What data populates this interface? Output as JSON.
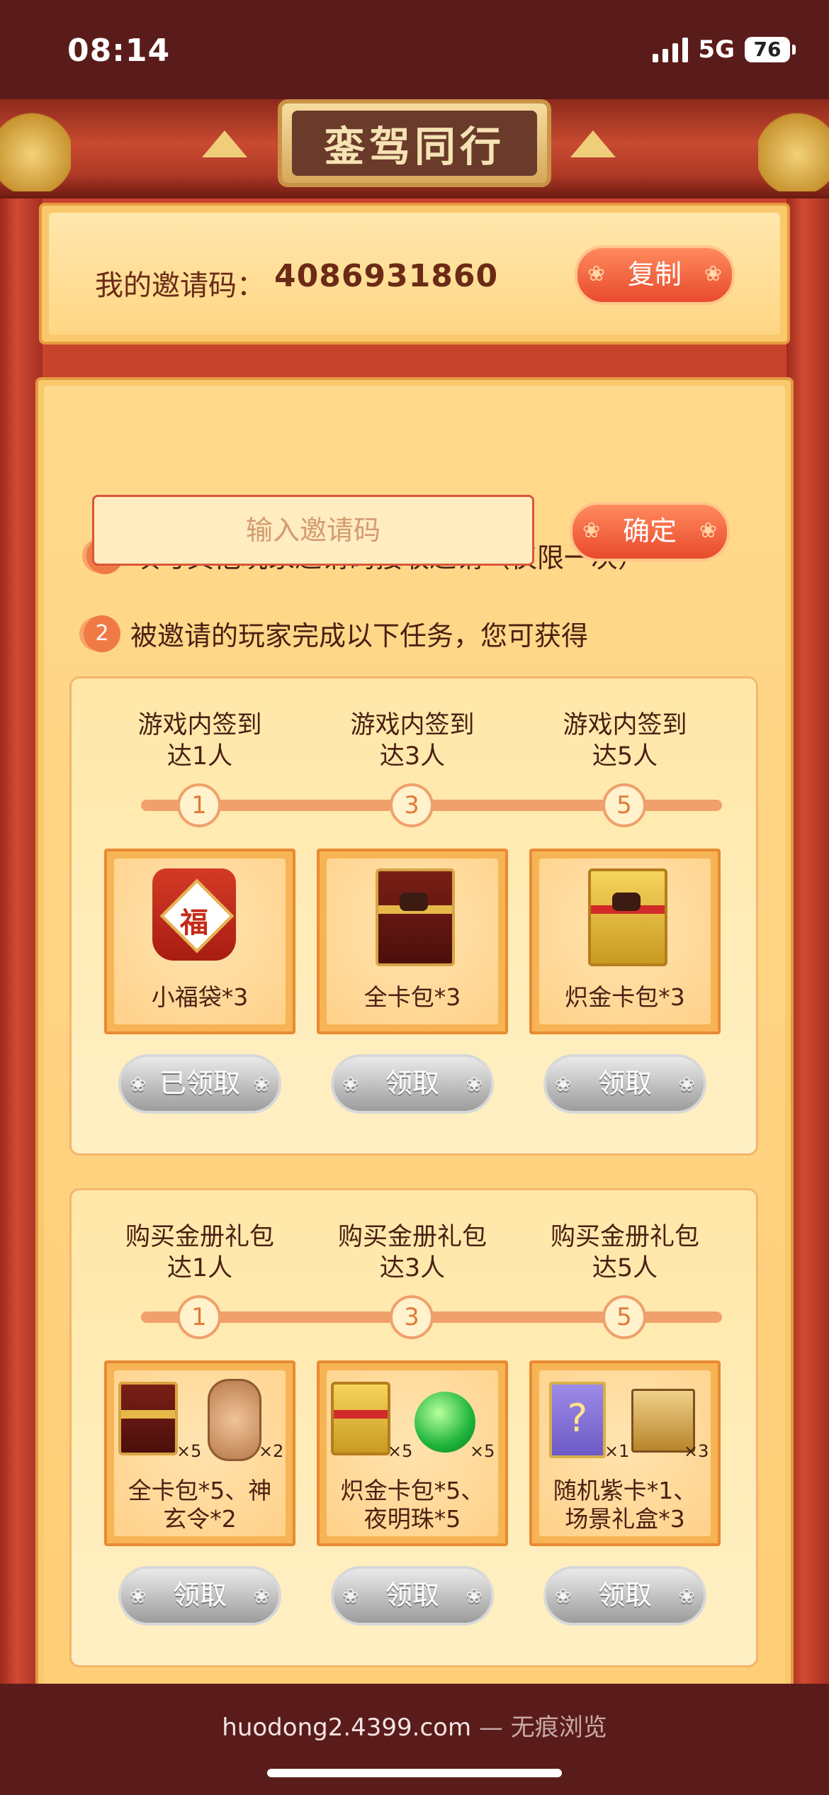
{
  "status": {
    "time": "08:14",
    "network": "5G",
    "battery": "76"
  },
  "page": {
    "title": "銮驾同行"
  },
  "invite": {
    "label": "我的邀请码：",
    "code": "4086931860",
    "copy_label": "复制"
  },
  "step1": {
    "num": "1",
    "text": "填写其他玩家邀请码接收邀请（仅限一次）",
    "placeholder": "输入邀请码",
    "confirm_label": "确定"
  },
  "step2": {
    "num": "2",
    "text": "被邀请的玩家完成以下任务，您可获得"
  },
  "group1": {
    "tiers": [
      {
        "cond1": "游戏内签到",
        "cond2": "达1人",
        "node": "1",
        "reward": "小福袋*3",
        "button": "已领取"
      },
      {
        "cond1": "游戏内签到",
        "cond2": "达3人",
        "node": "3",
        "reward": "全卡包*3",
        "button": "领取"
      },
      {
        "cond1": "游戏内签到",
        "cond2": "达5人",
        "node": "5",
        "reward": "炽金卡包*3",
        "button": "领取"
      }
    ],
    "fu_char": "福"
  },
  "group2": {
    "tiers": [
      {
        "cond1": "购买金册礼包",
        "cond2": "达1人",
        "node": "1",
        "reward1": "全卡包*5、神",
        "reward2": "玄令*2",
        "button": "领取",
        "mult_a": "×5",
        "mult_b": "×2"
      },
      {
        "cond1": "购买金册礼包",
        "cond2": "达3人",
        "node": "3",
        "reward1": "炽金卡包*5、",
        "reward2": "夜明珠*5",
        "button": "领取",
        "mult_a": "×5",
        "mult_b": "×5"
      },
      {
        "cond1": "购买金册礼包",
        "cond2": "达5人",
        "node": "5",
        "reward1": "随机紫卡*1、",
        "reward2": "场景礼盒*3",
        "button": "领取",
        "mult_a": "×1",
        "mult_b": "×3"
      }
    ],
    "question_mark": "?"
  },
  "browser": {
    "domain": "huodong2.4399.com",
    "suffix": " — 无痕浏览"
  },
  "icons": [
    "signal-icon",
    "battery-icon",
    "lucky-bag-icon",
    "card-pack-icon",
    "gold-card-pack-icon",
    "token-icon",
    "pearl-icon",
    "purple-card-icon",
    "gift-box-icon"
  ],
  "colors": {
    "bar_bg": "#5a1c1a",
    "accent_red": "#e84a2c",
    "panel": "#ffd98c",
    "text_dark": "#4b1f12"
  }
}
